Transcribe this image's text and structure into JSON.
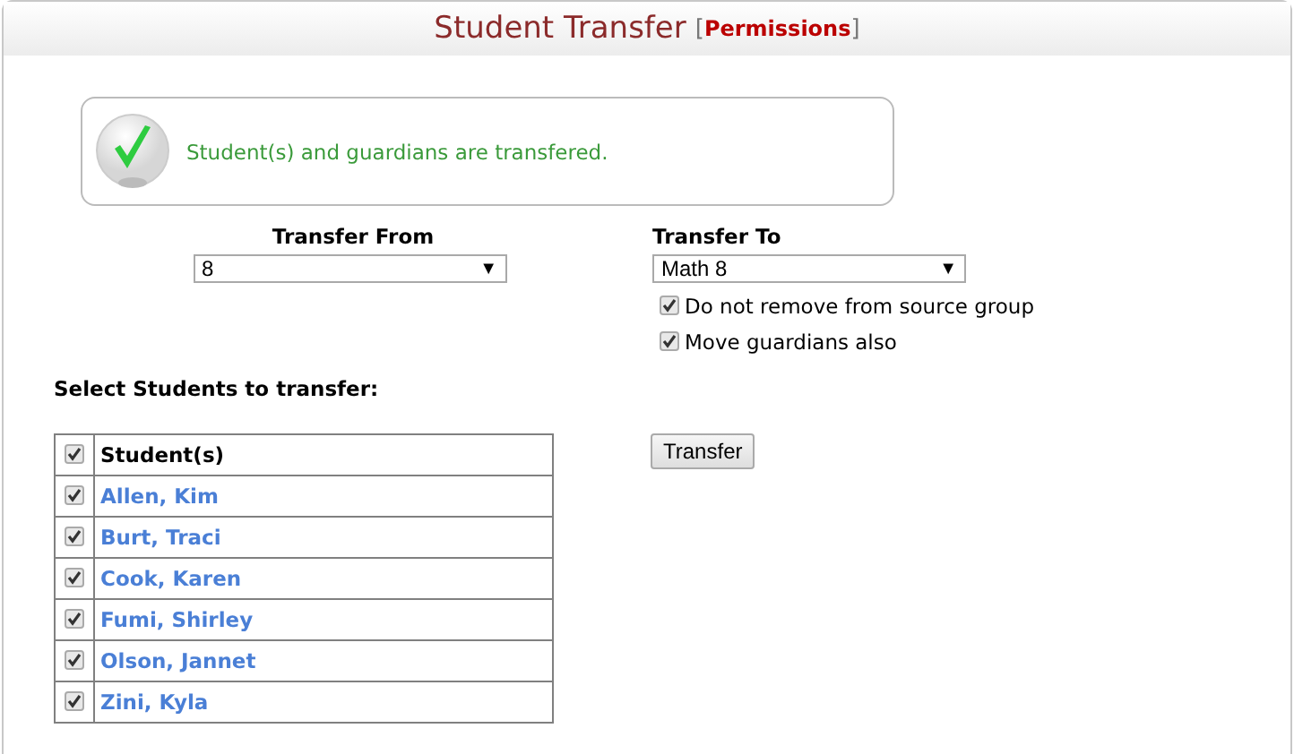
{
  "header": {
    "title": "Student Transfer",
    "link_open": "[",
    "link": "Permissions",
    "link_close": "]"
  },
  "message": {
    "text": "Student(s) and guardians are transfered."
  },
  "transfer_from": {
    "label": "Transfer From",
    "value": "8",
    "arrow": "▼"
  },
  "transfer_to": {
    "label": "Transfer To",
    "value": "Math 8",
    "arrow": "▼"
  },
  "options": [
    {
      "label": "Do not remove from source group",
      "checked": true
    },
    {
      "label": "Move guardians also",
      "checked": true
    }
  ],
  "select_label": "Select Students to transfer:",
  "table": {
    "header_checked": true,
    "column": "Student(s)",
    "rows": [
      {
        "name": "Allen, Kim",
        "checked": true
      },
      {
        "name": "Burt, Traci",
        "checked": true
      },
      {
        "name": "Cook, Karen",
        "checked": true
      },
      {
        "name": "Fumi, Shirley",
        "checked": true
      },
      {
        "name": "Olson, Jannet",
        "checked": true
      },
      {
        "name": "Zini, Kyla",
        "checked": true
      }
    ]
  },
  "transfer_button": "Transfer"
}
